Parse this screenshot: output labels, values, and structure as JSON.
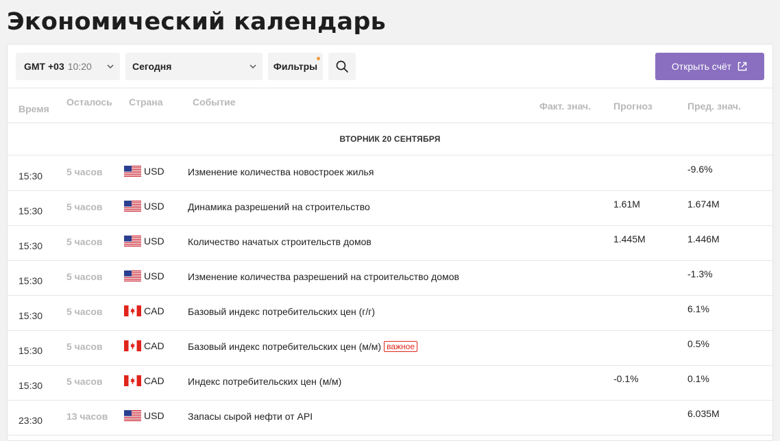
{
  "page": {
    "title": "Экономический календарь"
  },
  "toolbar": {
    "timezone": {
      "gmt": "GMT +03",
      "time": "10:20"
    },
    "period": "Сегодня",
    "filters_label": "Фильтры",
    "open_account_label": "Открыть счёт"
  },
  "columns": {
    "time": "Время",
    "left": "Осталось",
    "country": "Страна",
    "event": "Событие",
    "actual": "Факт. знач.",
    "forecast": "Прогноз",
    "previous": "Пред. знач."
  },
  "date_header": "ВТОРНИК 20 СЕНТЯБРЯ",
  "events": [
    {
      "time": "15:30",
      "left": "5 часов",
      "flag": "us-flag-icon",
      "currency": "USD",
      "event": "Изменение количества новостроек жилья",
      "badge": "",
      "actual": "",
      "forecast": "",
      "previous": "-9.6%"
    },
    {
      "time": "15:30",
      "left": "5 часов",
      "flag": "us-flag-icon",
      "currency": "USD",
      "event": "Динамика разрешений на строительство",
      "badge": "",
      "actual": "",
      "forecast": "1.61M",
      "previous": "1.674M"
    },
    {
      "time": "15:30",
      "left": "5 часов",
      "flag": "us-flag-icon",
      "currency": "USD",
      "event": "Количество начатых строительств домов",
      "badge": "",
      "actual": "",
      "forecast": "1.445M",
      "previous": "1.446M"
    },
    {
      "time": "15:30",
      "left": "5 часов",
      "flag": "us-flag-icon",
      "currency": "USD",
      "event": "Изменение количества разрешений на строительство домов",
      "badge": "",
      "actual": "",
      "forecast": "",
      "previous": "-1.3%"
    },
    {
      "time": "15:30",
      "left": "5 часов",
      "flag": "ca-flag-icon",
      "currency": "CAD",
      "event": "Базовый индекс потребительских цен (г/г)",
      "badge": "",
      "actual": "",
      "forecast": "",
      "previous": "6.1%"
    },
    {
      "time": "15:30",
      "left": "5 часов",
      "flag": "ca-flag-icon",
      "currency": "CAD",
      "event": "Базовый индекс потребительских цен (м/м)",
      "badge": "важное",
      "actual": "",
      "forecast": "",
      "previous": "0.5%"
    },
    {
      "time": "15:30",
      "left": "5 часов",
      "flag": "ca-flag-icon",
      "currency": "CAD",
      "event": "Индекс потребительских цен (м/м)",
      "badge": "",
      "actual": "",
      "forecast": "-0.1%",
      "previous": "0.1%"
    },
    {
      "time": "23:30",
      "left": "13 часов",
      "flag": "us-flag-icon",
      "currency": "USD",
      "event": "Запасы сырой нефти от API",
      "badge": "",
      "actual": "",
      "forecast": "",
      "previous": "6.035M"
    }
  ],
  "colors": {
    "accent": "#8a6fc0",
    "important": "#e0241b",
    "filter_dot": "#f39a3a",
    "muted_text": "#b8b8b8"
  }
}
